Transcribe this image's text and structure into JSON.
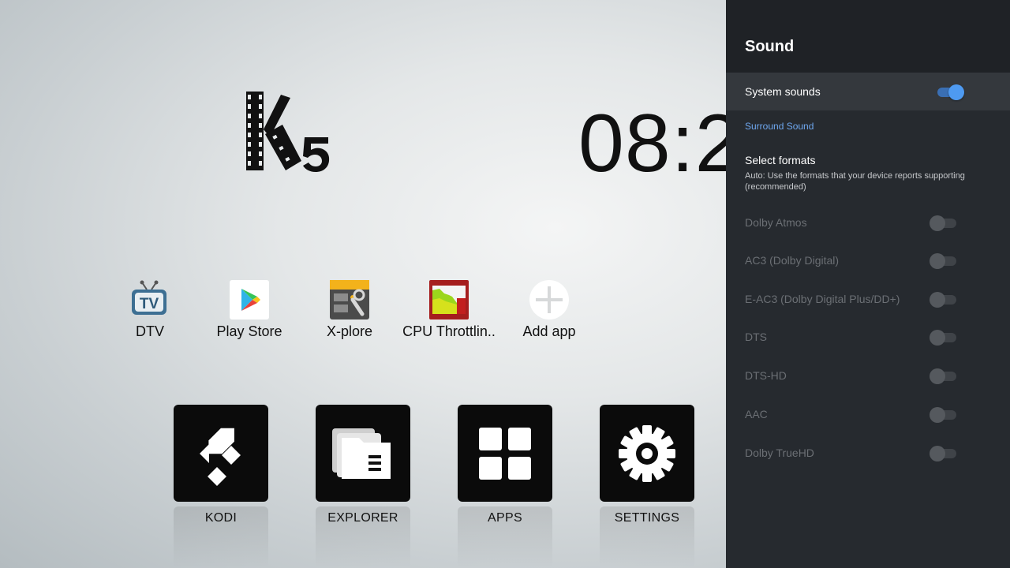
{
  "launcher": {
    "brand": "K5",
    "clock": "08:2",
    "shortcuts": [
      {
        "label": "DTV",
        "icon": "tv-icon"
      },
      {
        "label": "Play Store",
        "icon": "play-store-icon"
      },
      {
        "label": "X-plore",
        "icon": "xplore-icon"
      },
      {
        "label": "CPU Throttlin..",
        "icon": "cpu-throttling-icon"
      },
      {
        "label": "Add app",
        "icon": "add-icon"
      }
    ],
    "tiles": [
      {
        "label": "KODI",
        "icon": "kodi-icon"
      },
      {
        "label": "EXPLORER",
        "icon": "folder-icon"
      },
      {
        "label": "APPS",
        "icon": "grid-icon"
      },
      {
        "label": "SETTINGS",
        "icon": "gear-icon"
      }
    ]
  },
  "sound_panel": {
    "title": "Sound",
    "system_sounds": {
      "label": "System sounds",
      "enabled": true
    },
    "section": "Surround Sound",
    "select_formats": {
      "title": "Select formats",
      "description": "Auto: Use the formats that your device reports supporting (recommended)"
    },
    "formats": [
      {
        "label": "Dolby Atmos",
        "enabled": false
      },
      {
        "label": "AC3 (Dolby Digital)",
        "enabled": false
      },
      {
        "label": "E-AC3 (Dolby Digital Plus/DD+)",
        "enabled": false
      },
      {
        "label": "DTS",
        "enabled": false
      },
      {
        "label": "DTS-HD",
        "enabled": false
      },
      {
        "label": "AAC",
        "enabled": false
      },
      {
        "label": "Dolby TrueHD",
        "enabled": false
      }
    ],
    "colors": {
      "accent": "#4e9af1",
      "section": "#6fa8f0",
      "panel": "#262a2f"
    }
  }
}
